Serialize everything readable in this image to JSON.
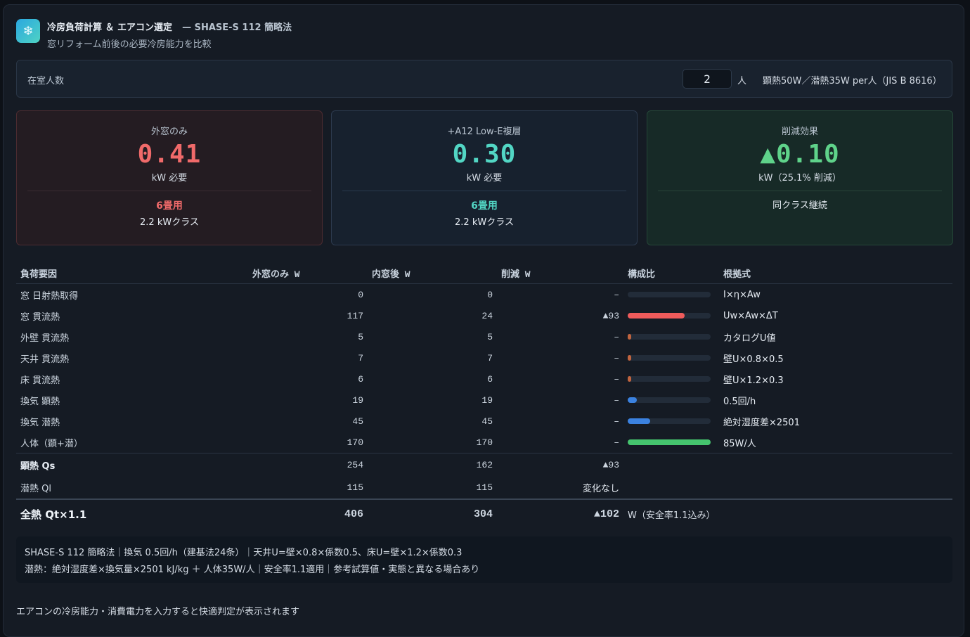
{
  "header": {
    "title": "冷房負荷計算 ＆ エアコン選定",
    "standard": "— SHASE-S 112 簡略法",
    "subtitle": "窓リフォーム前後の必要冷房能力を比較",
    "icon": "snowflake-icon"
  },
  "occupants": {
    "label": "在室人数",
    "value": "2",
    "unit": "人",
    "note": "顕熱50W／潜熱35W per人（JIS B 8616）"
  },
  "cards": {
    "before": {
      "label": "外窓のみ",
      "value": "0.41",
      "unit": "kW 必要",
      "size": "6畳用",
      "class": "2.2 kWクラス"
    },
    "after": {
      "label": "+A12 Low-E複層",
      "value": "0.30",
      "unit": "kW 必要",
      "size": "6畳用",
      "class": "2.2 kWクラス"
    },
    "saving": {
      "label": "削減効果",
      "value": "▲0.10",
      "unit": "kW（25.1% 削減）",
      "note": "同クラス継続"
    }
  },
  "table": {
    "headers": [
      "負荷要因",
      "外窓のみ W",
      "内窓後 W",
      "削減 W",
      "構成比",
      "根拠式"
    ],
    "rows": [
      {
        "name": "窓 日射熱取得",
        "before": "0",
        "after": "0",
        "saving": "–",
        "ratio": 0,
        "bar_color": "#6b4a52",
        "formula": "I×η×Aw"
      },
      {
        "name": "窓 貫流熱",
        "before": "117",
        "after": "24",
        "saving": "▲93",
        "ratio": 0.69,
        "bar_color": "#ef5b5b",
        "formula": "Uw×Aw×ΔT"
      },
      {
        "name": "外壁 貫流熱",
        "before": "5",
        "after": "5",
        "saving": "–",
        "ratio": 0.03,
        "bar_color": "#c0643f",
        "formula": "カタログU値"
      },
      {
        "name": "天井 貫流熱",
        "before": "7",
        "after": "7",
        "saving": "–",
        "ratio": 0.04,
        "bar_color": "#c0643f",
        "formula": "壁U×0.8×0.5"
      },
      {
        "name": "床 貫流熱",
        "before": "6",
        "after": "6",
        "saving": "–",
        "ratio": 0.035,
        "bar_color": "#c0643f",
        "formula": "壁U×1.2×0.3"
      },
      {
        "name": "換気 顕熱",
        "before": "19",
        "after": "19",
        "saving": "–",
        "ratio": 0.11,
        "bar_color": "#3b82e0",
        "formula": "0.5回/h"
      },
      {
        "name": "換気 潜熱",
        "before": "45",
        "after": "45",
        "saving": "–",
        "ratio": 0.27,
        "bar_color": "#3b82e0",
        "formula": "絶対湿度差×2501"
      },
      {
        "name": "人体（顕+潜）",
        "before": "170",
        "after": "170",
        "saving": "–",
        "ratio": 1.0,
        "bar_color": "#45c46e",
        "formula": "85W/人"
      }
    ],
    "sensible": {
      "name": "顕熱 Qs",
      "before": "254",
      "after": "162",
      "saving": "▲93"
    },
    "latent": {
      "name": "潜熱 Ql",
      "before": "115",
      "after": "115",
      "saving": "変化なし"
    },
    "total": {
      "name": "全熱 Qt×1.1",
      "before": "406",
      "after": "304",
      "saving": "▲102",
      "unit": "W（安全率1.1込み）"
    }
  },
  "notes": {
    "line1": "SHASE-S 112 簡略法｜換気 0.5回/h（建基法24条）｜天井U=壁×0.8×係数0.5、床U=壁×1.2×係数0.3",
    "line2": "潜熱：絶対湿度差×換気量×2501 kJ/kg ＋ 人体35W/人｜安全率1.1適用｜参考試算値・実態と異なる場合あり"
  },
  "footer": "エアコンの冷房能力・消費電力を入力すると快適判定が表示されます",
  "colors": {
    "before": "#f06a6a",
    "after": "#52d6c4",
    "saving": "#5fd28a"
  }
}
